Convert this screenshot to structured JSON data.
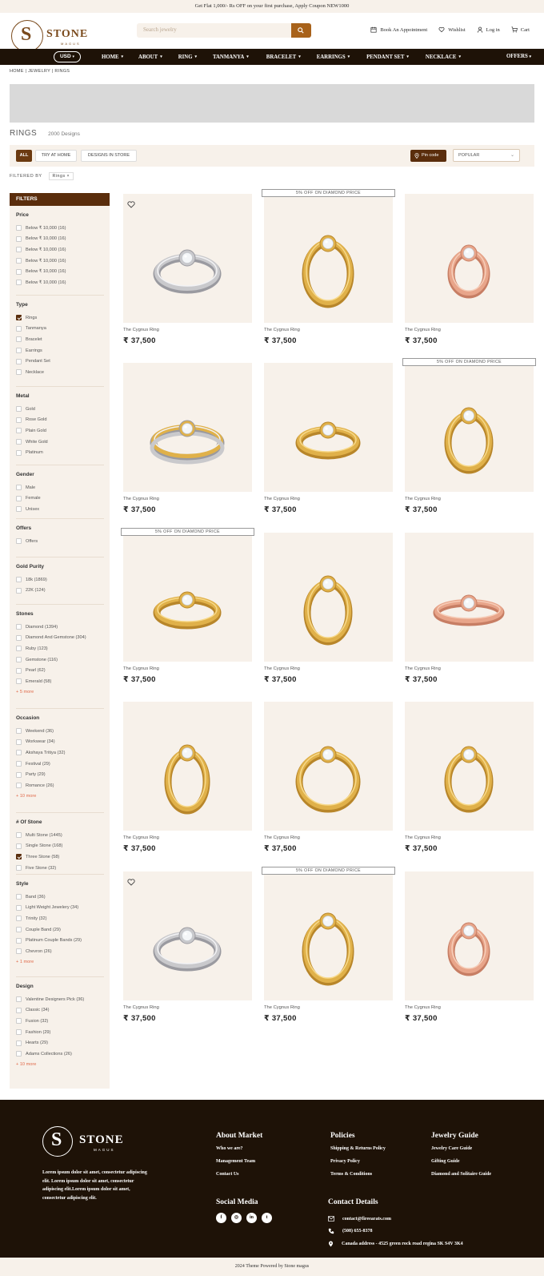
{
  "announcement": "Get Flat 1,000/- Rs OFF on your first purchase, Apply Coupon NEW1000",
  "header": {
    "logo_text": "STONE",
    "logo_sub": "MAGUS",
    "logo_initial": "S",
    "search_placeholder": "Search jewelry",
    "links": {
      "appointment": "Book An Appointment",
      "wishlist": "Wishlist",
      "login": "Log in",
      "cart": "Cart"
    }
  },
  "nav": {
    "currency": "USD",
    "items": [
      "HOME",
      "ABOUT",
      "RING",
      "TANMANYA",
      "BRACELET",
      "EARRINGS",
      "PENDANT SET",
      "NECKLACE"
    ],
    "offers": "OFFERS"
  },
  "breadcrumb": "HOME | JEWELRY | RINGS",
  "page": {
    "title": "RINGS",
    "count": "2000 Designs"
  },
  "filterbar": {
    "chips": [
      "ALL",
      "TRY AT HOME",
      "DESIGNS IN STORE"
    ],
    "pincode": "Pin code",
    "sort": "POPULAR",
    "filtered_by_label": "FILTERED BY",
    "filtered_tag": "Rings ×"
  },
  "sidebar": {
    "header": "FILTERS",
    "groups": [
      {
        "title": "Price",
        "options": [
          {
            "label": "Below ₹ 10,000 (16)",
            "checked": false
          },
          {
            "label": "Below ₹ 10,000 (16)",
            "checked": false
          },
          {
            "label": "Below ₹ 10,000 (16)",
            "checked": false
          },
          {
            "label": "Below ₹ 10,000 (16)",
            "checked": false
          },
          {
            "label": "Below ₹ 10,000 (16)",
            "checked": false
          },
          {
            "label": "Below ₹ 10,000 (16)",
            "checked": false
          }
        ],
        "more": ""
      },
      {
        "title": "Type",
        "options": [
          {
            "label": "Rings",
            "checked": true
          },
          {
            "label": "Tanmanya",
            "checked": false
          },
          {
            "label": "Bracelet",
            "checked": false
          },
          {
            "label": "Earrings",
            "checked": false
          },
          {
            "label": "Pendant Set",
            "checked": false
          },
          {
            "label": "Necklace",
            "checked": false
          }
        ],
        "more": ""
      },
      {
        "title": "Metal",
        "options": [
          {
            "label": "Gold",
            "checked": false
          },
          {
            "label": "Rose Gold",
            "checked": false
          },
          {
            "label": "Plain Gold",
            "checked": false
          },
          {
            "label": "White Gold",
            "checked": false
          },
          {
            "label": "Platinum",
            "checked": false
          }
        ],
        "more": ""
      },
      {
        "title": "Gender",
        "options": [
          {
            "label": "Male",
            "checked": false
          },
          {
            "label": "Female",
            "checked": false
          },
          {
            "label": "Unisex",
            "checked": false
          }
        ],
        "more": ""
      },
      {
        "title": "Offers",
        "options": [
          {
            "label": "Offers",
            "checked": false
          }
        ],
        "more": ""
      },
      {
        "title": "Gold Purity",
        "options": [
          {
            "label": "18k (1869)",
            "checked": false
          },
          {
            "label": "22K (124)",
            "checked": false
          }
        ],
        "more": ""
      },
      {
        "title": "Stones",
        "options": [
          {
            "label": "Diamond (1394)",
            "checked": false
          },
          {
            "label": "Diamond And Gemstone (304)",
            "checked": false
          },
          {
            "label": "Ruby (123)",
            "checked": false
          },
          {
            "label": "Gemstone (116)",
            "checked": false
          },
          {
            "label": "Pearl (62)",
            "checked": false
          },
          {
            "label": "Emerald (58)",
            "checked": false
          }
        ],
        "more": "+ 5 more"
      },
      {
        "title": "Occasion",
        "options": [
          {
            "label": "Weekend (36)",
            "checked": false
          },
          {
            "label": "Workwear (34)",
            "checked": false
          },
          {
            "label": "Akshaya Tritiya (32)",
            "checked": false
          },
          {
            "label": "Festival (29)",
            "checked": false
          },
          {
            "label": "Party (29)",
            "checked": false
          },
          {
            "label": "Romance (26)",
            "checked": false
          }
        ],
        "more": "+ 10 more"
      },
      {
        "title": "# Of Stone",
        "options": [
          {
            "label": "Multi Stone (1445)",
            "checked": false
          },
          {
            "label": "Single Stone (168)",
            "checked": false
          },
          {
            "label": "Three Stone (58)",
            "checked": true
          },
          {
            "label": "Five Stone (32)",
            "checked": false
          }
        ],
        "more": ""
      },
      {
        "title": "Style",
        "options": [
          {
            "label": "Band (36)",
            "checked": false
          },
          {
            "label": "Light Weight Jewelery (34)",
            "checked": false
          },
          {
            "label": "Trinity (32)",
            "checked": false
          },
          {
            "label": "Couple Band (29)",
            "checked": false
          },
          {
            "label": "Platinum Couple Bands (29)",
            "checked": false
          },
          {
            "label": "Chevron (26)",
            "checked": false
          }
        ],
        "more": "+ 1 more"
      },
      {
        "title": "Design",
        "options": [
          {
            "label": "Valentine Designers Pick (36)",
            "checked": false
          },
          {
            "label": "Classic (34)",
            "checked": false
          },
          {
            "label": "Fusion (32)",
            "checked": false
          },
          {
            "label": "Fashion (29)",
            "checked": false
          },
          {
            "label": "Hearts (29)",
            "checked": false
          },
          {
            "label": "Adams Collections (26)",
            "checked": false
          }
        ],
        "more": "+ 10 more"
      }
    ]
  },
  "products": [
    {
      "name": "The Cygnus Ring",
      "price": "₹ 37,500",
      "tag": "",
      "wishlist": true,
      "metal": "silver"
    },
    {
      "name": "The Cygnus Ring",
      "price": "₹ 37,500",
      "tag": "5% OFF ON DIAMOND PRICE",
      "wishlist": false,
      "metal": "gold"
    },
    {
      "name": "The Cygnus Ring",
      "price": "₹ 37,500",
      "tag": "",
      "wishlist": false,
      "metal": "rose"
    },
    {
      "name": "The Cygnus Ring",
      "price": "₹ 37,500",
      "tag": "",
      "wishlist": false,
      "metal": "twotone"
    },
    {
      "name": "The Cygnus Ring",
      "price": "₹ 37,500",
      "tag": "",
      "wishlist": false,
      "metal": "gold"
    },
    {
      "name": "The Cygnus Ring",
      "price": "₹ 37,500",
      "tag": "5% OFF ON DIAMOND PRICE",
      "wishlist": false,
      "metal": "gold"
    },
    {
      "name": "The Cygnus Ring",
      "price": "₹ 37,500",
      "tag": "5% OFF ON DIAMOND PRICE",
      "wishlist": false,
      "metal": "gold"
    },
    {
      "name": "The Cygnus Ring",
      "price": "₹ 37,500",
      "tag": "",
      "wishlist": false,
      "metal": "gold"
    },
    {
      "name": "The Cygnus Ring",
      "price": "₹ 37,500",
      "tag": "",
      "wishlist": false,
      "metal": "rose"
    },
    {
      "name": "The Cygnus Ring",
      "price": "₹ 37,500",
      "tag": "",
      "wishlist": false,
      "metal": "gold"
    },
    {
      "name": "The Cygnus Ring",
      "price": "₹ 37,500",
      "tag": "",
      "wishlist": false,
      "metal": "gold"
    },
    {
      "name": "The Cygnus Ring",
      "price": "₹ 37,500",
      "tag": "",
      "wishlist": false,
      "metal": "gold"
    },
    {
      "name": "The Cygnus Ring",
      "price": "₹ 37,500",
      "tag": "",
      "wishlist": true,
      "metal": "silver"
    },
    {
      "name": "The Cygnus Ring",
      "price": "₹ 37,500",
      "tag": "5% OFF ON DIAMOND PRICE",
      "wishlist": false,
      "metal": "gold"
    },
    {
      "name": "The Cygnus Ring",
      "price": "₹ 37,500",
      "tag": "",
      "wishlist": false,
      "metal": "rose"
    }
  ],
  "footer": {
    "about_text": "Lorem ipsum dolor sit amet, consectetur adipiscing elit. Lorem ipsum dolor sit amet, consectetur adipiscing elit.Lorem ipsum dolor sit amet, consectetur adipiscing elit.",
    "about_market": {
      "title": "About Market",
      "links": [
        "Who we are?",
        "Management Team",
        "Contact Us"
      ]
    },
    "policies": {
      "title": "Policies",
      "links": [
        "Shipping & Returns Policy",
        "Privacy Policy",
        "Terms & Conditions"
      ]
    },
    "guide": {
      "title": "Jewelry Guide",
      "links": [
        "Jewelry Care Guide",
        "Gifting Guide",
        "Diamond and Solitaire Guide"
      ]
    },
    "social_title": "Social Media",
    "socials": [
      "f",
      "◎",
      "in",
      "t"
    ],
    "contact_title": "Contact Details",
    "email": "contact@fireearats.com",
    "phone": "(508) 655-8378",
    "address": "Canada address - 4525 green rock road  regina SK S4V 3K4",
    "copyright": "2024 Theme Powered by Stone magus"
  },
  "colors": {
    "brand_dark": "#1e1207",
    "brand_brown": "#5a2d0c",
    "accent": "#a8621a",
    "cream": "#f7f1ea"
  }
}
